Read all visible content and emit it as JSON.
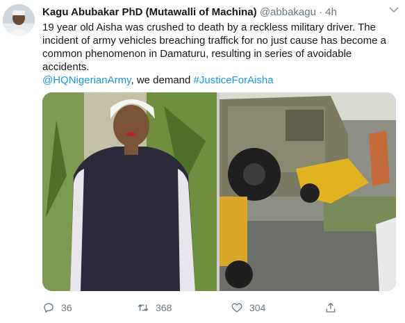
{
  "tweet": {
    "author_name": "Kagu Abubakar PhD (Mutawalli of Machina)",
    "author_handle": "@abbakagu",
    "separator": "·",
    "time": "4h",
    "text_line": "19 year old Aisha was crushed to death by a reckless military driver. The incident of army vehicles breaching traffick for no just cause has become a common phenomenon in Damaturu, resulting in series of avoidable accidents.",
    "mention": "@HQNigerianArmy",
    "text_mid": ", we demand ",
    "hashtag": "#JusticeForAisha"
  },
  "actions": {
    "replies": "36",
    "retweets": "368",
    "likes": "304"
  },
  "icons": {
    "avatar": "user-avatar",
    "menu": "chevron-down-icon",
    "reply": "reply-icon",
    "retweet": "retweet-icon",
    "like": "heart-icon",
    "share": "share-icon"
  },
  "colors": {
    "link": "#1b95e0",
    "secondary_text": "#657786",
    "primary_text": "#14171a"
  }
}
